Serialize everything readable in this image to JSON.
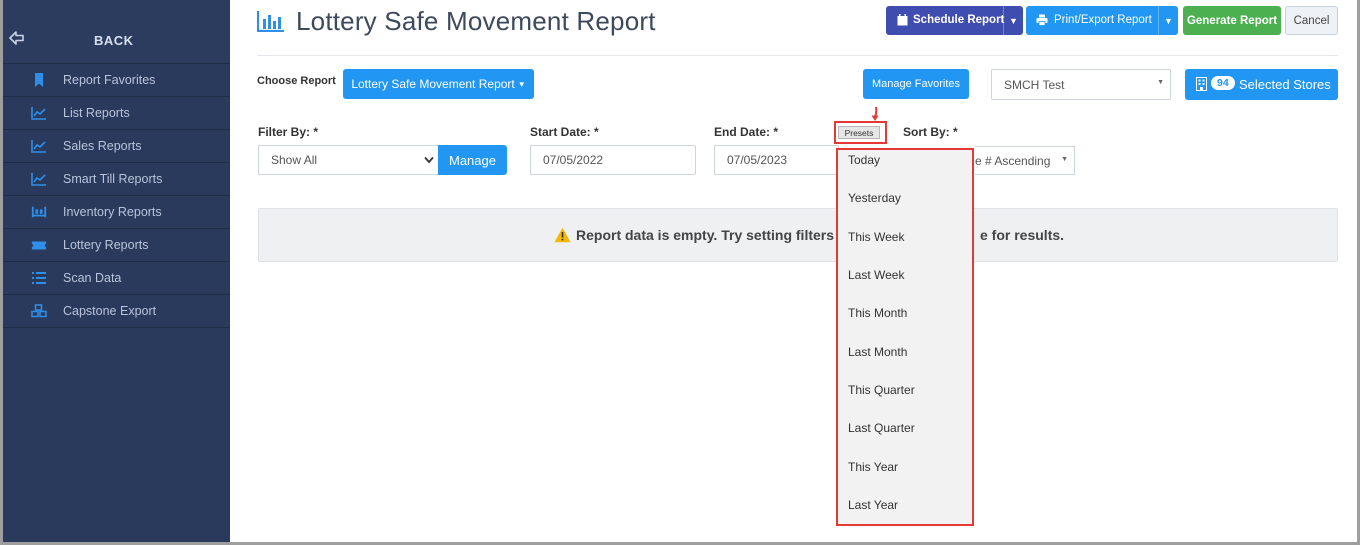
{
  "sidebar": {
    "back_label": "BACK",
    "items": [
      {
        "label": "Report Favorites",
        "icon": "bookmark-icon"
      },
      {
        "label": "List Reports",
        "icon": "chart-line-icon"
      },
      {
        "label": "Sales Reports",
        "icon": "chart-line-icon"
      },
      {
        "label": "Smart Till Reports",
        "icon": "chart-line-icon"
      },
      {
        "label": "Inventory Reports",
        "icon": "pallet-icon"
      },
      {
        "label": "Lottery Reports",
        "icon": "ticket-icon"
      },
      {
        "label": "Scan Data",
        "icon": "list-icon"
      },
      {
        "label": "Capstone Export",
        "icon": "boxes-icon"
      }
    ]
  },
  "header": {
    "title": "Lottery Safe Movement Report",
    "schedule_label": "Schedule Report",
    "print_label": "Print/Export Report",
    "generate_label": "Generate Report",
    "cancel_label": "Cancel"
  },
  "report_row": {
    "choose_label": "Choose Report",
    "report_value": "Lottery Safe Movement Report",
    "manage_favorites_label": "Manage Favorites",
    "store_group_value": "SMCH Test",
    "store_count": "94",
    "selected_stores_label": "Selected Stores"
  },
  "filters": {
    "filter_by_label": "Filter By: *",
    "filter_value": "Show All",
    "manage_label": "Manage",
    "start_label": "Start Date: *",
    "start_value": "07/05/2022",
    "end_label": "End Date: *",
    "end_value": "07/05/2023",
    "presets_label": "Presets",
    "sort_label": "Sort By: *",
    "sort_value": "e # Ascending"
  },
  "presets": [
    "Today",
    "Yesterday",
    "This Week",
    "Last Week",
    "This Month",
    "Last Month",
    "This Quarter",
    "Last Quarter",
    "This Year",
    "Last Year"
  ],
  "empty": {
    "message_left": "Report data is empty. Try setting filters or",
    "message_right": "e for results."
  },
  "colors": {
    "sidebar_bg": "#2a3a5c",
    "accent_blue": "#2196f3",
    "purple": "#3f4cb0",
    "green": "#4caf50",
    "highlight_red": "#e53935"
  }
}
